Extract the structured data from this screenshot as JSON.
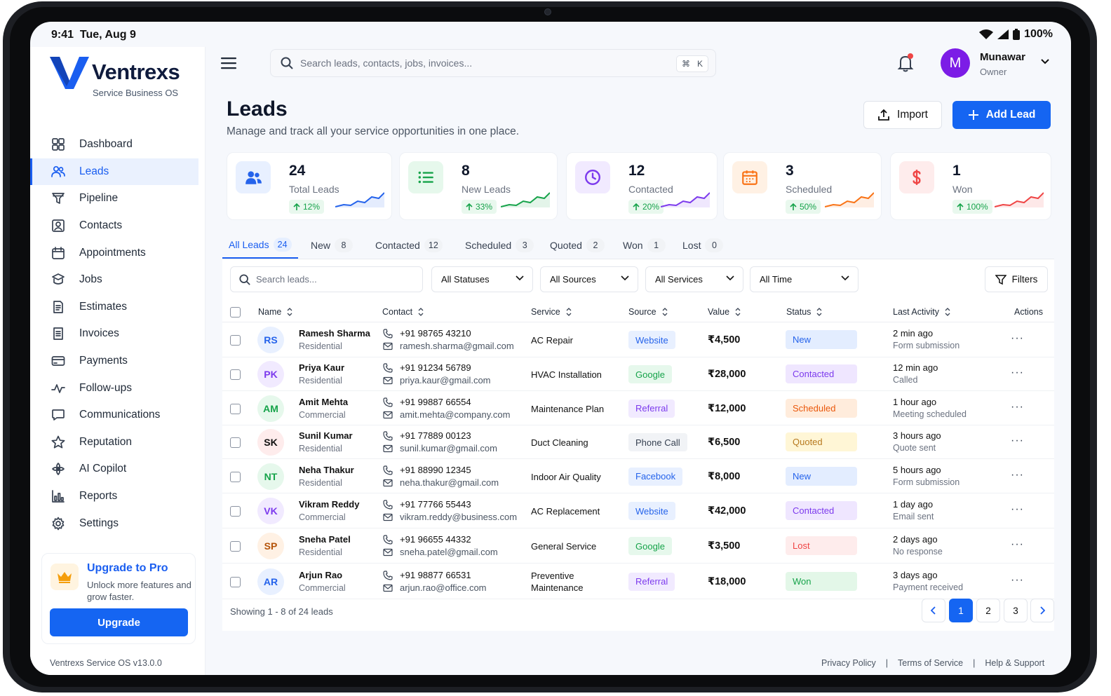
{
  "status_bar": {
    "time": "9:41",
    "date": "Tue, Aug 9",
    "battery": "100%"
  },
  "brand": {
    "name": "Ventrexs",
    "tagline": "Service Business OS",
    "colors": {
      "primary": "#1565f2",
      "logo": "#1a5ef0"
    }
  },
  "sidebar": {
    "items": [
      {
        "label": "Dashboard",
        "icon": "grid-icon"
      },
      {
        "label": "Leads",
        "icon": "users-icon",
        "active": true
      },
      {
        "label": "Pipeline",
        "icon": "funnel-icon"
      },
      {
        "label": "Contacts",
        "icon": "contact-card-icon"
      },
      {
        "label": "Appointments",
        "icon": "calendar-icon"
      },
      {
        "label": "Jobs",
        "icon": "jobs-icon"
      },
      {
        "label": "Estimates",
        "icon": "document-icon"
      },
      {
        "label": "Invoices",
        "icon": "invoice-icon"
      },
      {
        "label": "Payments",
        "icon": "card-icon"
      },
      {
        "label": "Follow-ups",
        "icon": "activity-icon"
      },
      {
        "label": "Communications",
        "icon": "chat-icon"
      },
      {
        "label": "Reputation",
        "icon": "star-icon"
      },
      {
        "label": "AI Copilot",
        "icon": "copilot-icon"
      },
      {
        "label": "Reports",
        "icon": "chart-icon"
      },
      {
        "label": "Settings",
        "icon": "gear-icon"
      }
    ],
    "upgrade": {
      "title": "Upgrade to Pro",
      "desc": "Unlock more features and grow faster.",
      "button": "Upgrade"
    },
    "version": "Ventrexs Service OS  v13.0.0"
  },
  "topbar": {
    "search_placeholder": "Search leads, contacts, jobs, invoices...",
    "shortcut_cmd": "⌘",
    "shortcut_key": "K",
    "user": {
      "initial": "M",
      "name": "Munawar",
      "role": "Owner"
    }
  },
  "page": {
    "title": "Leads",
    "subtitle": "Manage and track all your service opportunities in one place.",
    "import_label": "Import",
    "add_label": "Add Lead"
  },
  "stats": [
    {
      "value": "24",
      "label": "Total Leads",
      "change": "12%",
      "color": "#2563eb",
      "bg": "#e8f0ff",
      "icon": "users-icon"
    },
    {
      "value": "8",
      "label": "New Leads",
      "change": "33%",
      "color": "#16a34a",
      "bg": "#e6f8ec",
      "icon": "list-icon"
    },
    {
      "value": "12",
      "label": "Contacted",
      "change": "20%",
      "color": "#7c3aed",
      "bg": "#f1eaff",
      "icon": "clock-icon"
    },
    {
      "value": "3",
      "label": "Scheduled",
      "change": "50%",
      "color": "#f97316",
      "bg": "#fff1e4",
      "icon": "calendar-icon"
    },
    {
      "value": "1",
      "label": "Won",
      "change": "100%",
      "color": "#ef4444",
      "bg": "#feecec",
      "icon": "dollar-icon"
    }
  ],
  "tabs": [
    {
      "label": "All Leads",
      "count": "24",
      "active": true
    },
    {
      "label": "New",
      "count": "8"
    },
    {
      "label": "Contacted",
      "count": "12"
    },
    {
      "label": "Scheduled",
      "count": "3"
    },
    {
      "label": "Quoted",
      "count": "2"
    },
    {
      "label": "Won",
      "count": "1"
    },
    {
      "label": "Lost",
      "count": "0"
    }
  ],
  "filters": {
    "search_placeholder": "Search leads...",
    "status": "All Statuses",
    "source": "All Sources",
    "service": "All Services",
    "time": "All Time",
    "filters_label": "Filters"
  },
  "table": {
    "columns": [
      "Name",
      "Contact",
      "Service",
      "Source",
      "Value",
      "Status",
      "Last Activity",
      "Actions"
    ],
    "rows": [
      {
        "initials": "RS",
        "name": "Ramesh Sharma",
        "type": "Residential",
        "phone": "+91 98765 43210",
        "email": "ramesh.sharma@gmail.com",
        "service": "AC Repair",
        "source": "Website",
        "value": "₹4,500",
        "status": "New",
        "activity": "2 min ago",
        "activity_detail": "Form submission"
      },
      {
        "initials": "PK",
        "name": "Priya Kaur",
        "type": "Residential",
        "phone": "+91 91234 56789",
        "email": "priya.kaur@gmail.com",
        "service": "HVAC Installation",
        "source": "Google",
        "value": "₹28,000",
        "status": "Contacted",
        "activity": "12 min ago",
        "activity_detail": "Called"
      },
      {
        "initials": "AM",
        "name": "Amit Mehta",
        "type": "Commercial",
        "phone": "+91 99887 66554",
        "email": "amit.mehta@company.com",
        "service": "Maintenance Plan",
        "source": "Referral",
        "value": "₹12,000",
        "status": "Scheduled",
        "activity": "1 hour ago",
        "activity_detail": "Meeting scheduled"
      },
      {
        "initials": "SK",
        "name": "Sunil Kumar",
        "type": "Residential",
        "phone": "+91 77889 00123",
        "email": "sunil.kumar@gmail.com",
        "service": "Duct Cleaning",
        "source": "Phone Call",
        "value": "₹6,500",
        "status": "Quoted",
        "activity": "3 hours ago",
        "activity_detail": "Quote sent"
      },
      {
        "initials": "NT",
        "name": "Neha Thakur",
        "type": "Residential",
        "phone": "+91 88990 12345",
        "email": "neha.thakur@gmail.com",
        "service": "Indoor Air Quality",
        "source": "Facebook",
        "value": "₹8,000",
        "status": "New",
        "activity": "5 hours ago",
        "activity_detail": "Form submission"
      },
      {
        "initials": "VK",
        "name": "Vikram Reddy",
        "type": "Commercial",
        "phone": "+91 77766 55443",
        "email": "vikram.reddy@business.com",
        "service": "AC Replacement",
        "source": "Website",
        "value": "₹42,000",
        "status": "Contacted",
        "activity": "1 day ago",
        "activity_detail": "Email sent"
      },
      {
        "initials": "SP",
        "name": "Sneha Patel",
        "type": "Residential",
        "phone": "+91 96655 44332",
        "email": "sneha.patel@gmail.com",
        "service": "General Service",
        "source": "Google",
        "value": "₹3,500",
        "status": "Lost",
        "activity": "2 days ago",
        "activity_detail": "No response"
      },
      {
        "initials": "AR",
        "name": "Arjun Rao",
        "type": "Commercial",
        "phone": "+91 98877 66531",
        "email": "arjun.rao@office.com",
        "service": "Preventive Maintenance",
        "source": "Referral",
        "value": "₹18,000",
        "status": "Won",
        "activity": "3 days ago",
        "activity_detail": "Payment received"
      }
    ],
    "actions_glyph": "···"
  },
  "pagination": {
    "showing": "Showing 1 - 8 of 24 leads",
    "pages": [
      "1",
      "2",
      "3"
    ],
    "current": "1"
  },
  "footer": {
    "links": [
      "Privacy Policy",
      "Terms of Service",
      "Help & Support"
    ],
    "separator": "|"
  }
}
